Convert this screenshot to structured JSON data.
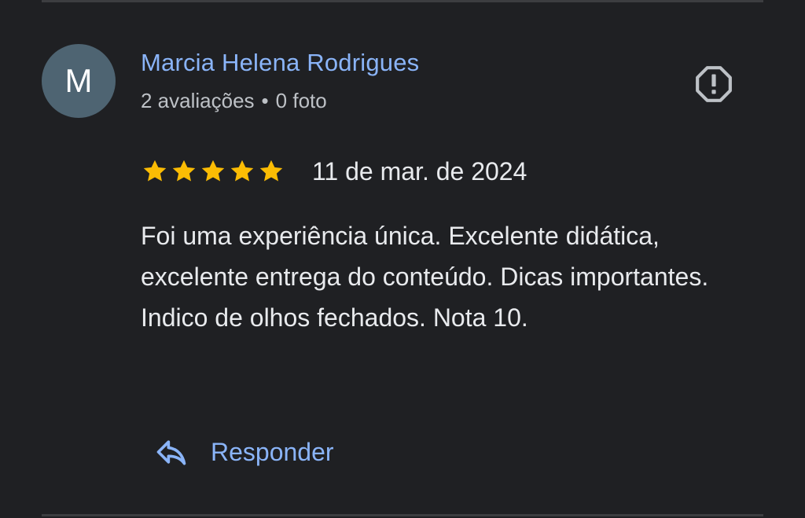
{
  "review": {
    "author": {
      "initial": "M",
      "name": "Marcia Helena Rodrigues",
      "reviews_count": "2 avaliações",
      "separator": "•",
      "photos_count": "0 foto"
    },
    "rating": 5,
    "rating_max": 5,
    "date": "11 de mar. de 2024",
    "text": "Foi uma experiência única. Excelente didática, excelente entrega do conteúdo. Dicas importantes. Indico de olhos fechados. Nota 10.",
    "report_icon": "report-flag-icon",
    "reply": {
      "icon": "reply-icon",
      "label": "Responder"
    }
  },
  "colors": {
    "background": "#1f2023",
    "accent": "#8ab4f8",
    "star": "#fbbc04",
    "avatar": "#4e6472",
    "text_primary": "#e8eaed",
    "text_secondary": "#bdc1c6"
  }
}
